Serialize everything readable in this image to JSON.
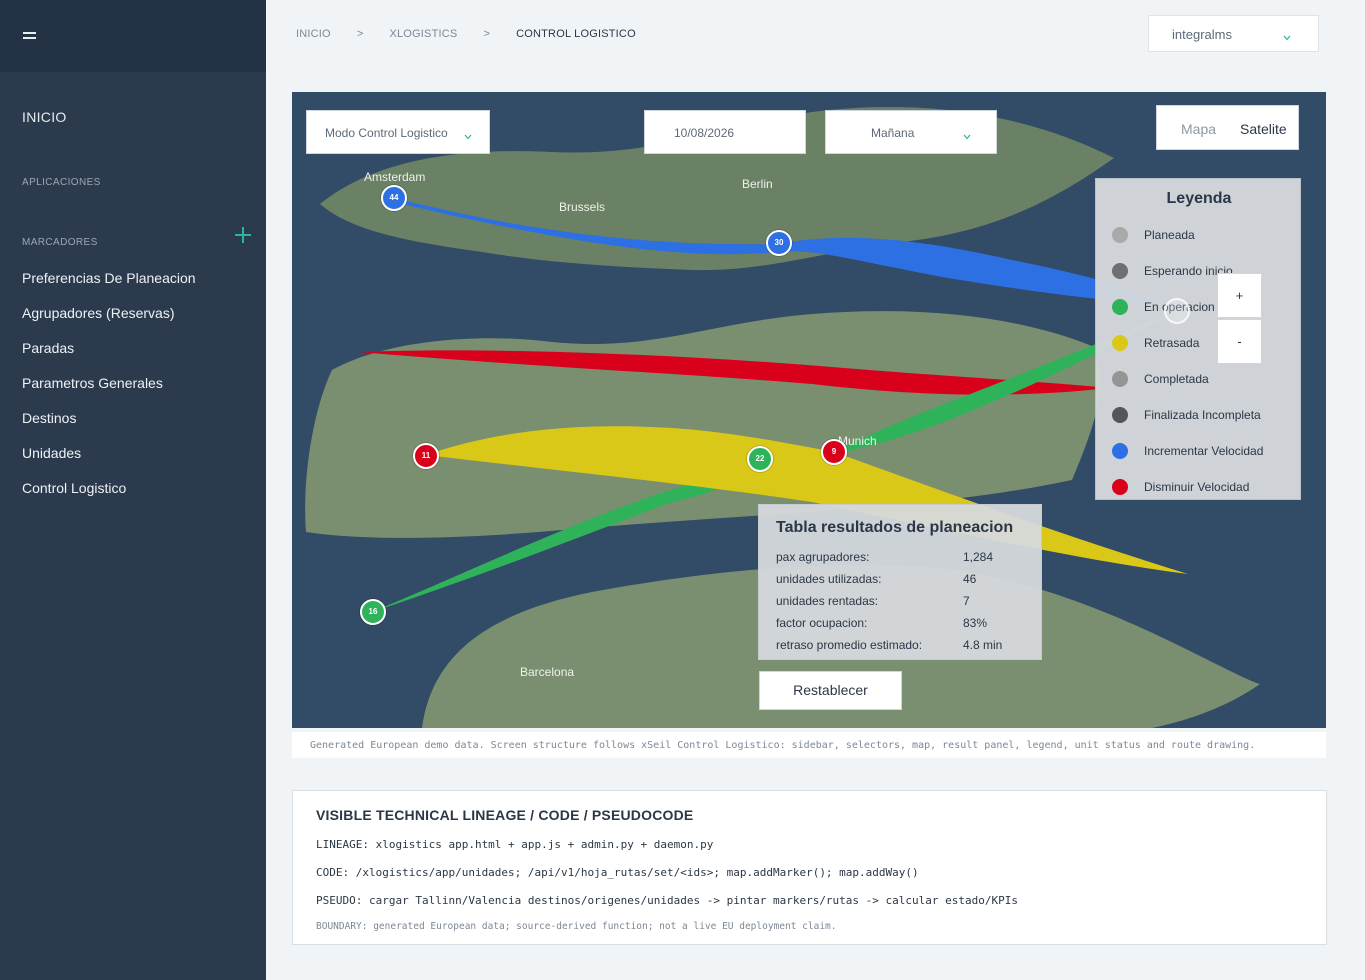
{
  "sidebar": {
    "home": "INICIO",
    "apps_section": "APLICACIONES",
    "markers_section": "MARCADORES",
    "add_icon": "plus-icon",
    "menu_icon": "hamburger-icon",
    "items": [
      {
        "label": "Preferencias De Planeacion"
      },
      {
        "label": "Agrupadores (Reservas)"
      },
      {
        "label": "Paradas"
      },
      {
        "label": "Parametros Generales"
      },
      {
        "label": "Destinos"
      },
      {
        "label": "Unidades"
      },
      {
        "label": "Control Logistico"
      }
    ]
  },
  "breadcrumb": {
    "items": [
      "INICIO",
      "XLOGISTICS",
      "CONTROL LOGISTICO"
    ],
    "separator": ">"
  },
  "tenant": {
    "value": "integralms"
  },
  "map": {
    "mode_select": "Modo Control Logistico",
    "date": "10/08/2026",
    "shift_select": "Mañana",
    "map_types": {
      "map": "Mapa",
      "satellite": "Satelite"
    },
    "zoom_in": "+",
    "zoom_out": "-",
    "cities": {
      "amsterdam": "Amsterdam",
      "brussels": "Brussels",
      "berlin": "Berlin",
      "munich": "Munich",
      "barcelona": "Barcelona"
    },
    "markers": [
      {
        "id": "44",
        "status_color": "#2d70e3"
      },
      {
        "id": "30",
        "status_color": "#2d70e3"
      },
      {
        "id": "11",
        "status_color": "#d9001b"
      },
      {
        "id": "22",
        "status_color": "#2fb35a"
      },
      {
        "id": "9",
        "status_color": "#d9001b"
      },
      {
        "id": "16",
        "status_color": "#2fb35a"
      }
    ],
    "land_color": "#79906e",
    "water_color": "#324b67"
  },
  "legend": {
    "title": "Leyenda",
    "items": [
      {
        "label": "Planeada",
        "color": "#a9a9a9"
      },
      {
        "label": "Esperando inicio",
        "color": "#6f6f6f"
      },
      {
        "label": "En operacion",
        "color": "#2fb35a"
      },
      {
        "label": "Retrasada",
        "color": "#d9c818"
      },
      {
        "label": "Completada",
        "color": "#959595"
      },
      {
        "label": "Finalizada Incompleta",
        "color": "#555555"
      },
      {
        "label": "Incrementar Velocidad",
        "color": "#2d70e3"
      },
      {
        "label": "Disminuir Velocidad",
        "color": "#d9001b"
      }
    ]
  },
  "results": {
    "title": "Tabla resultados de planeacion",
    "rows": [
      {
        "label": "pax agrupadores:",
        "value": "1,284"
      },
      {
        "label": "unidades utilizadas:",
        "value": "46"
      },
      {
        "label": "unidades rentadas:",
        "value": "7"
      },
      {
        "label": "factor ocupacion:",
        "value": "83%"
      },
      {
        "label": "retraso promedio estimado:",
        "value": "4.8 min"
      }
    ],
    "reset_button": "Restablecer"
  },
  "caption": "Generated European demo data. Screen structure follows xSeil Control Logistico: sidebar, selectors, map, result panel, legend, unit status and route drawing.",
  "lineage": {
    "title": "VISIBLE TECHNICAL LINEAGE / CODE / PSEUDOCODE",
    "lines": [
      "LINEAGE: xlogistics app.html + app.js + admin.py + daemon.py",
      "CODE: /xlogistics/app/unidades; /api/v1/hoja_rutas/set/<ids>; map.addMarker(); map.addWay()",
      "PSEUDO: cargar Tallinn/Valencia destinos/origenes/unidades -> pintar markers/rutas -> calcular estado/KPIs"
    ],
    "boundary": "BOUNDARY: generated European data; source-derived function; not a live EU deployment claim."
  }
}
